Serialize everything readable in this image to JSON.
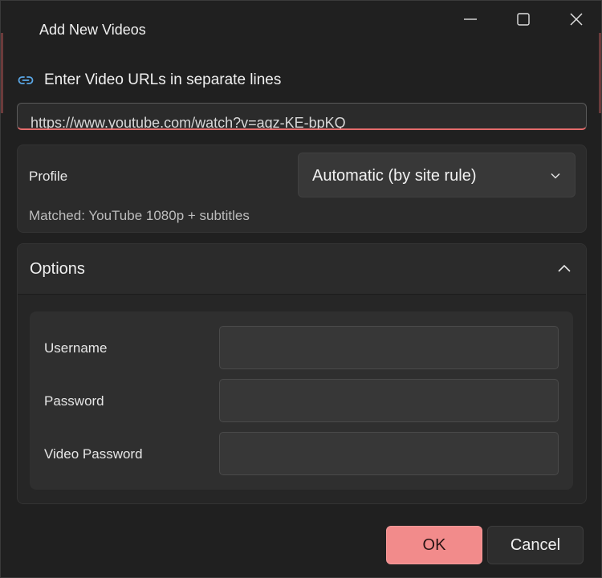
{
  "window": {
    "title": "Add New Videos"
  },
  "caption": {
    "minimize_icon": "minimize-icon",
    "maximize_icon": "maximize-icon",
    "close_icon": "close-icon"
  },
  "url_section": {
    "label": "Enter Video URLs in separate lines",
    "value": "https://www.youtube.com/watch?v=aqz-KE-bpKQ",
    "icon": "link-icon",
    "accent_color": "#e46b6b"
  },
  "profile": {
    "label": "Profile",
    "selected": "Automatic (by site rule)",
    "matched": "Matched: YouTube 1080p + subtitles"
  },
  "options": {
    "title": "Options",
    "expanded": true,
    "fields": [
      {
        "label": "Username",
        "value": ""
      },
      {
        "label": "Password",
        "value": ""
      },
      {
        "label": "Video Password",
        "value": ""
      }
    ]
  },
  "footer": {
    "ok_label": "OK",
    "cancel_label": "Cancel",
    "accent_color": "#f28b8b"
  }
}
